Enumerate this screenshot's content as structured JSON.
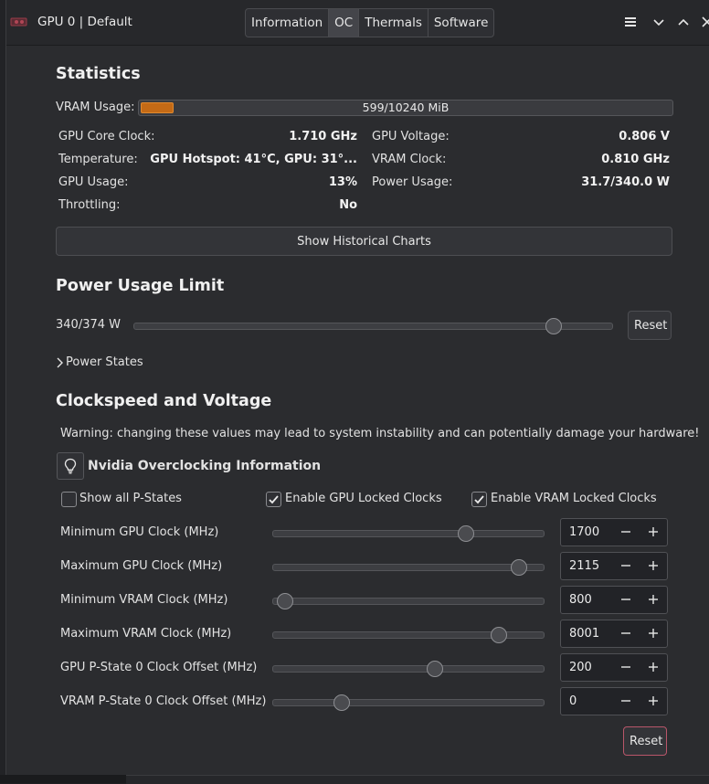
{
  "window": {
    "title": "GPU 0 | Default",
    "tabs": [
      {
        "label": "Information",
        "active": false
      },
      {
        "label": "OC",
        "active": true
      },
      {
        "label": "Thermals",
        "active": false
      },
      {
        "label": "Software",
        "active": false
      }
    ],
    "icons": [
      "menu-icon",
      "chevron-down-icon",
      "chevron-up-icon",
      "close-icon"
    ]
  },
  "statistics": {
    "title": "Statistics",
    "vram_label": "VRAM Usage:",
    "vram_text": "599/10240 MiB",
    "vram_fraction": 0.0585,
    "left": [
      {
        "label": "GPU Core Clock:",
        "value": "1.710 GHz"
      },
      {
        "label": "Temperature:",
        "value": "GPU Hotspot: 41°C, GPU: 31°..."
      },
      {
        "label": "GPU Usage:",
        "value": "13%"
      },
      {
        "label": "Throttling:",
        "value": "No"
      }
    ],
    "right": [
      {
        "label": "GPU Voltage:",
        "value": "0.806 V"
      },
      {
        "label": "VRAM Clock:",
        "value": "0.810 GHz"
      },
      {
        "label": "Power Usage:",
        "value": "31.7/340.0 W"
      }
    ],
    "historical_button": "Show Historical Charts"
  },
  "power": {
    "title": "Power Usage Limit",
    "value_label": "340/374 W",
    "slider_fraction": 0.875,
    "reset_label": "Reset",
    "states_label": "Power States"
  },
  "clocks": {
    "title": "Clockspeed and Voltage",
    "warning": "Warning: changing these values may lead to system instability and can potentially damage your hardware!",
    "info_label": "Nvidia Overclocking Information",
    "checkboxes": [
      {
        "label": "Show all P-States",
        "checked": false
      },
      {
        "label": "Enable GPU Locked Clocks",
        "checked": true
      },
      {
        "label": "Enable VRAM Locked Clocks",
        "checked": true
      }
    ],
    "rows": [
      {
        "label": "Minimum GPU Clock (MHz)",
        "value": "1700",
        "slider": 0.71
      },
      {
        "label": "Maximum GPU Clock (MHz)",
        "value": "2115",
        "slider": 0.905
      },
      {
        "label": "Minimum VRAM Clock (MHz)",
        "value": "800",
        "slider": 0.04
      },
      {
        "label": "Maximum VRAM Clock (MHz)",
        "value": "8001",
        "slider": 0.83
      },
      {
        "label": "GPU P-State 0 Clock Offset (MHz)",
        "value": "200",
        "slider": 0.595
      },
      {
        "label": "VRAM P-State 0 Clock Offset (MHz)",
        "value": "0",
        "slider": 0.25
      }
    ],
    "reset_label": "Reset"
  },
  "colors": {
    "accent_orange": "#c46a16",
    "background": "#2b2c2f",
    "danger_border": "#b9566a"
  }
}
